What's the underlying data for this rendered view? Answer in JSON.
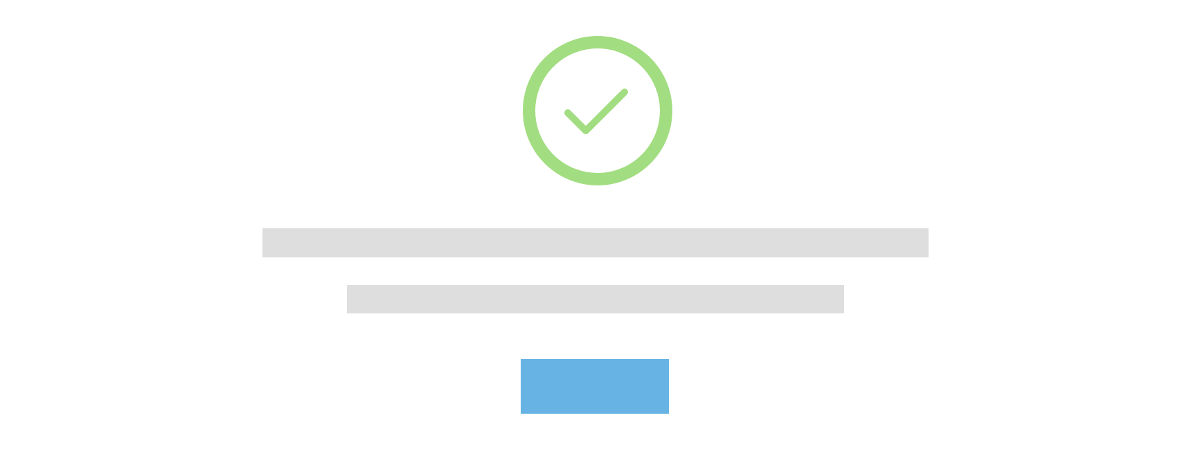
{
  "colors": {
    "success_green": "#a2dd81",
    "placeholder_gray": "#dedede",
    "button_blue": "#67b3e3",
    "background": "#ffffff"
  },
  "icons": {
    "success": "check-circle-icon"
  },
  "button": {
    "label": ""
  }
}
